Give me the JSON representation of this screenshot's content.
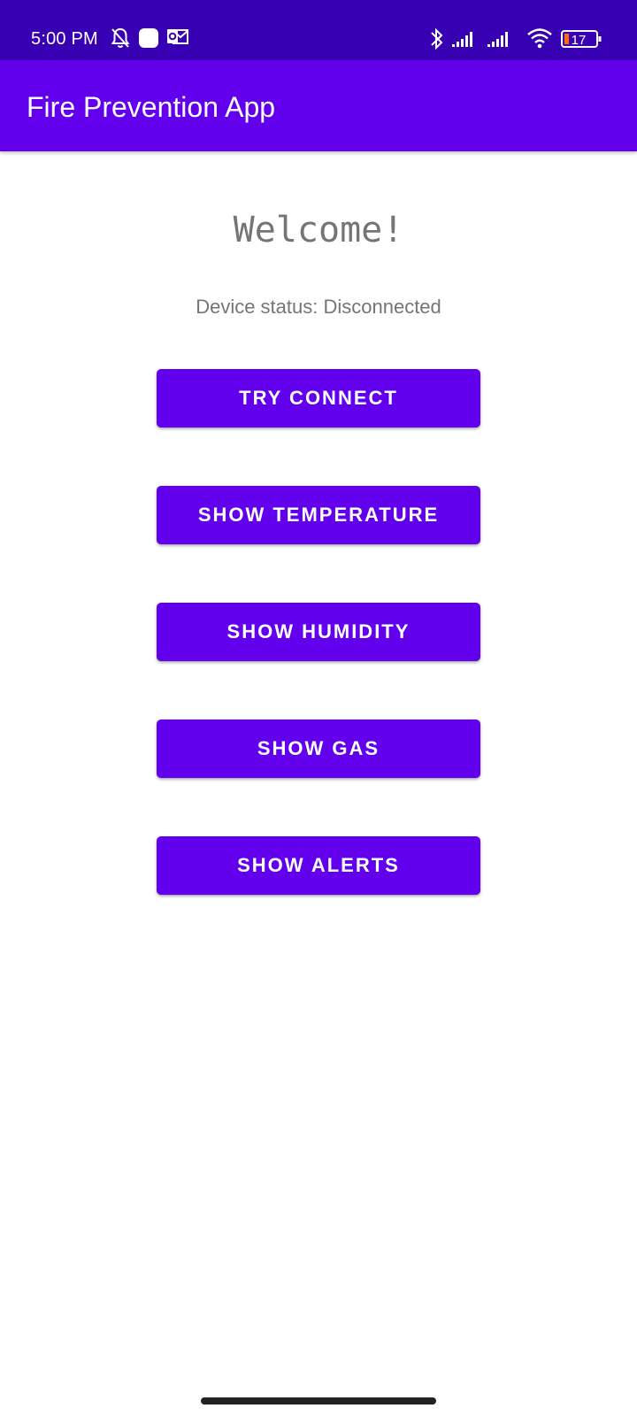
{
  "status_bar": {
    "time": "5:00 PM",
    "left_icons": [
      "muted-bell-icon",
      "square-notification-icon",
      "outlook-icon"
    ],
    "right_icons": [
      "bluetooth-icon",
      "signal-icon",
      "signal-icon",
      "wifi-icon",
      "battery-icon"
    ],
    "battery_level": "17"
  },
  "app_bar": {
    "title": "Fire Prevention App"
  },
  "main": {
    "welcome": "Welcome!",
    "device_status": "Device status: Disconnected",
    "buttons": {
      "try_connect": "TRY CONNECT",
      "show_temperature": "SHOW TEMPERATURE",
      "show_humidity": "SHOW HUMIDITY",
      "show_gas": "SHOW GAS",
      "show_alerts": "SHOW ALERTS"
    }
  },
  "colors": {
    "status_bar": "#3700b3",
    "primary": "#6200ee",
    "text_secondary": "#757575"
  }
}
